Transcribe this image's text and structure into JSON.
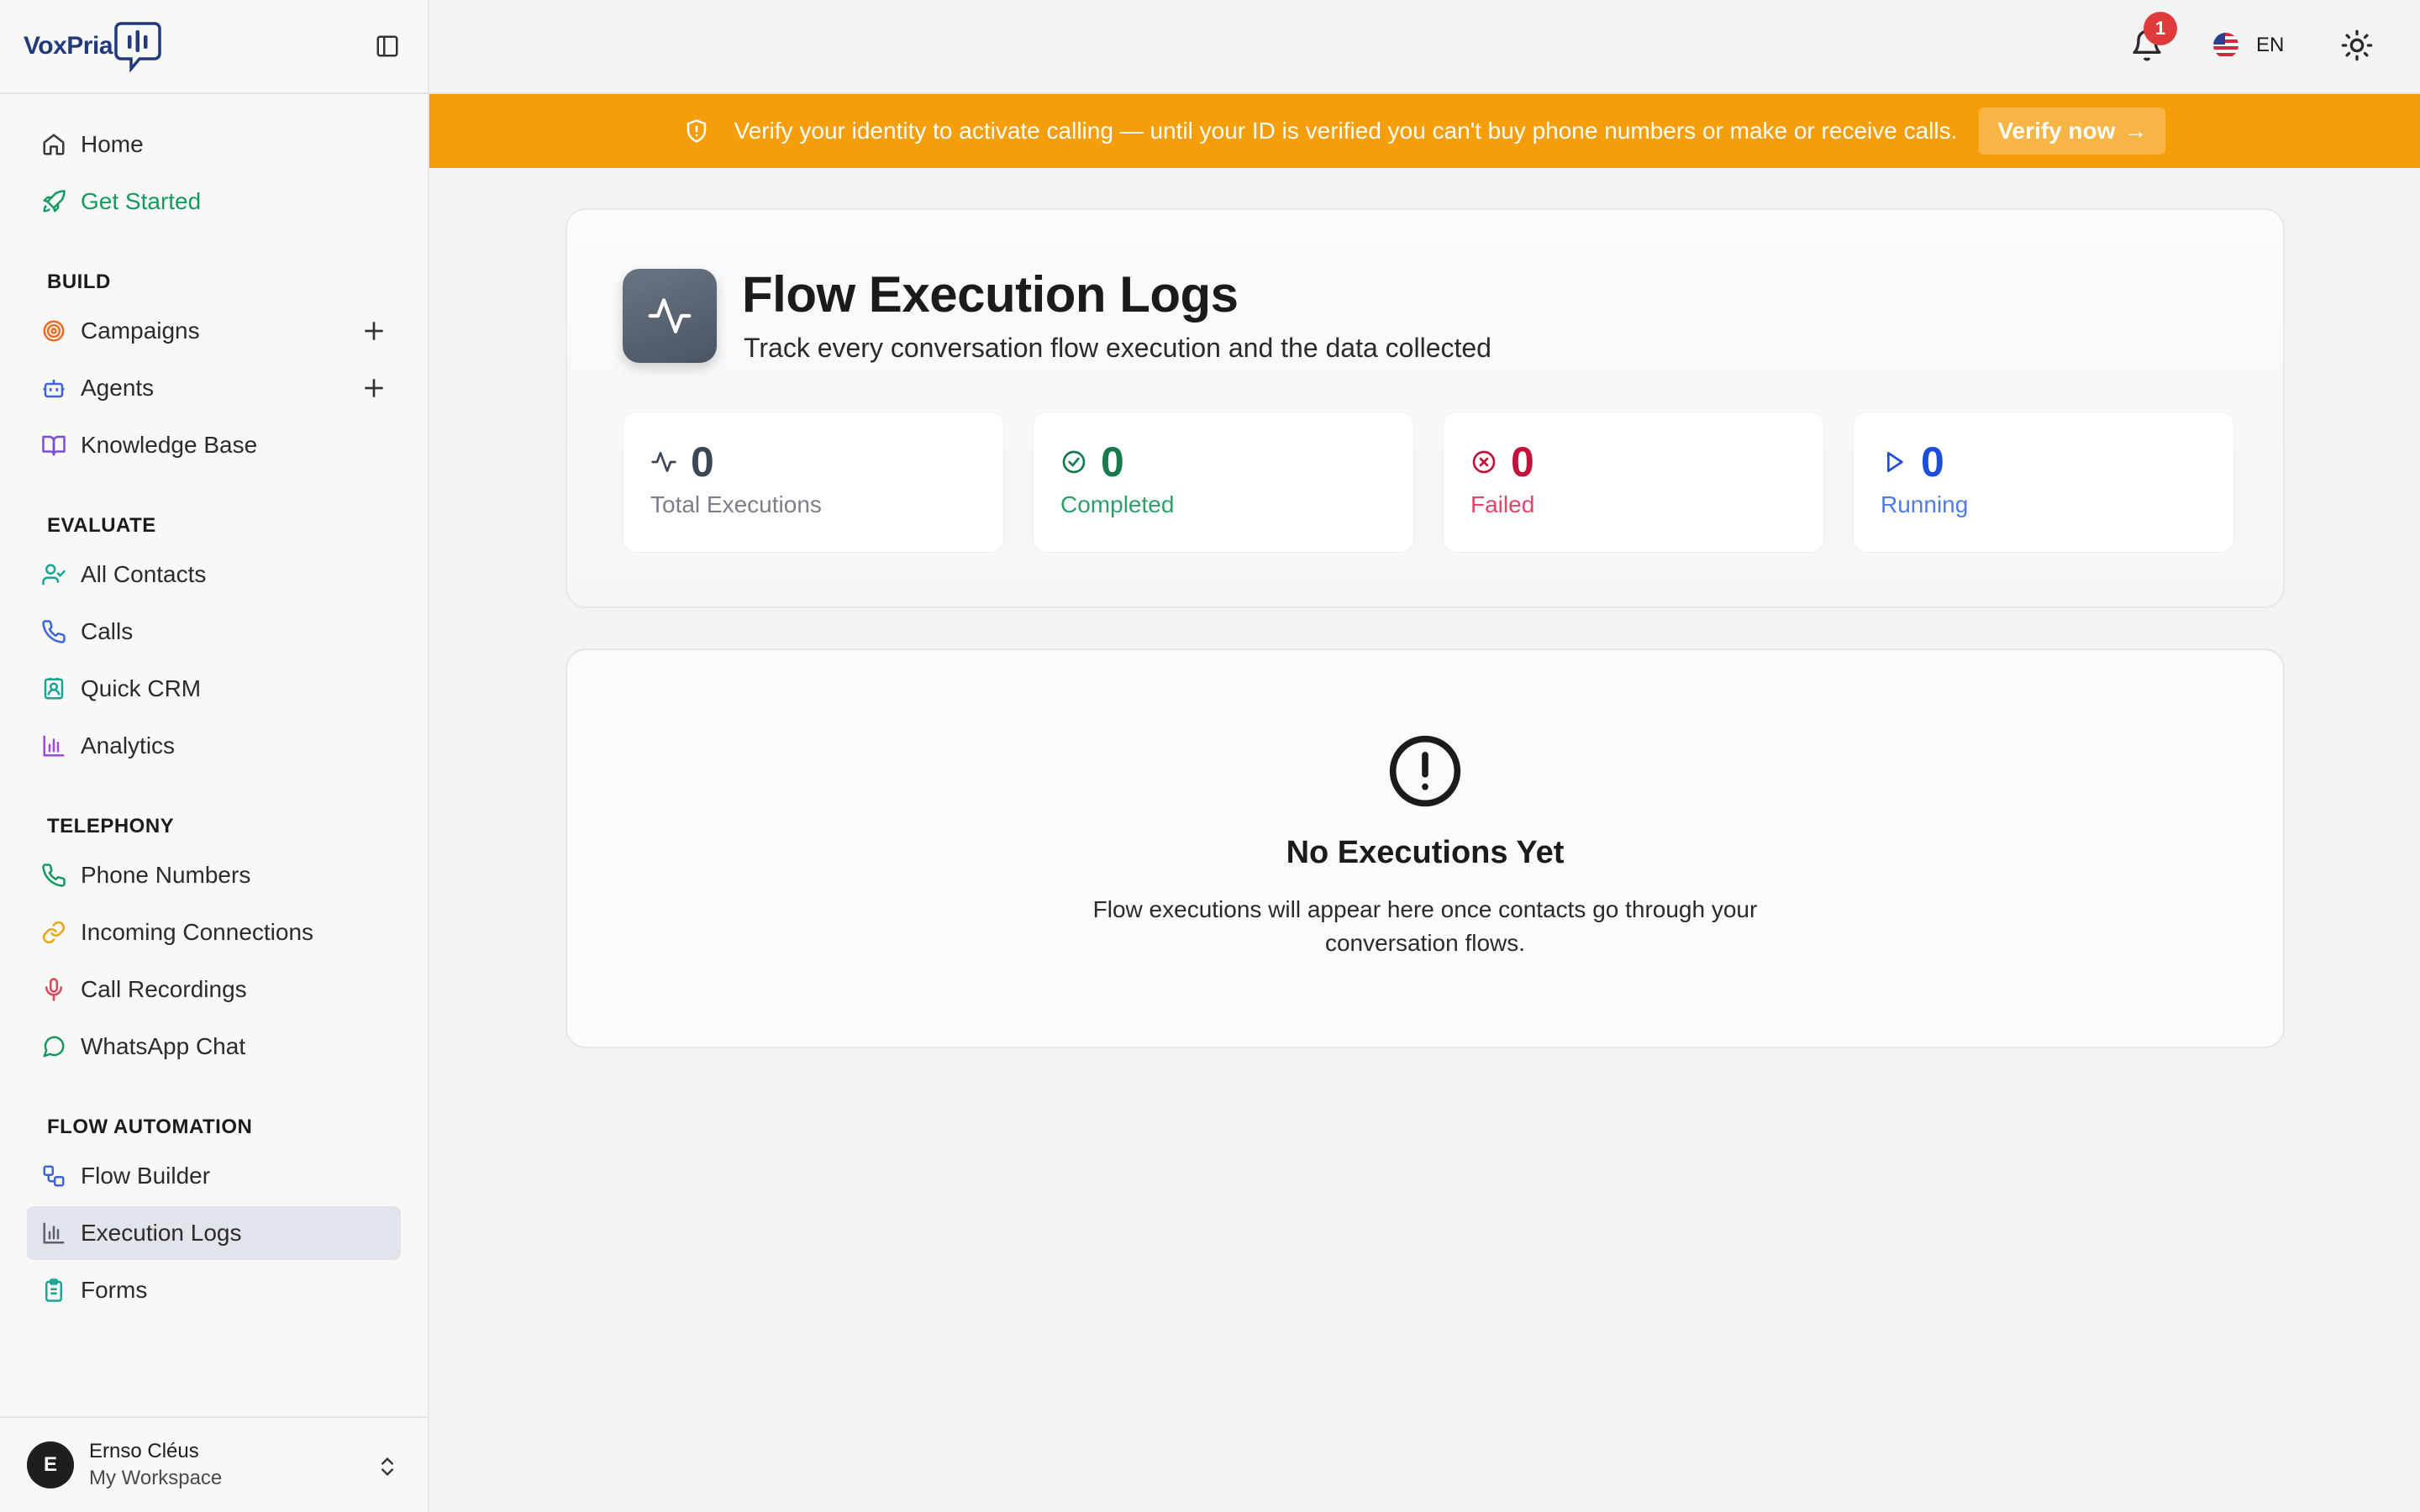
{
  "brand": {
    "name": "VoxPria"
  },
  "sidebar": {
    "top_items": [
      {
        "label": "Home",
        "icon": "home-icon"
      },
      {
        "label": "Get Started",
        "icon": "rocket-icon"
      }
    ],
    "sections": [
      {
        "title": "BUILD",
        "items": [
          {
            "label": "Campaigns",
            "icon": "target-icon",
            "has_add": true
          },
          {
            "label": "Agents",
            "icon": "bot-icon",
            "has_add": true
          },
          {
            "label": "Knowledge Base",
            "icon": "book-icon"
          }
        ]
      },
      {
        "title": "EVALUATE",
        "items": [
          {
            "label": "All Contacts",
            "icon": "user-check-icon"
          },
          {
            "label": "Calls",
            "icon": "phone-icon"
          },
          {
            "label": "Quick CRM",
            "icon": "contact-card-icon"
          },
          {
            "label": "Analytics",
            "icon": "bar-chart-icon"
          }
        ]
      },
      {
        "title": "TELEPHONY",
        "items": [
          {
            "label": "Phone Numbers",
            "icon": "phone-icon"
          },
          {
            "label": "Incoming Connections",
            "icon": "link-icon"
          },
          {
            "label": "Call Recordings",
            "icon": "mic-icon"
          },
          {
            "label": "WhatsApp Chat",
            "icon": "chat-bubble-icon"
          }
        ]
      },
      {
        "title": "FLOW AUTOMATION",
        "items": [
          {
            "label": "Flow Builder",
            "icon": "workflow-icon"
          },
          {
            "label": "Execution Logs",
            "icon": "bar-chart-icon",
            "active": true
          },
          {
            "label": "Forms",
            "icon": "clipboard-icon"
          }
        ]
      }
    ],
    "user": {
      "initial": "E",
      "name": "Ernso Cléus",
      "workspace": "My Workspace"
    }
  },
  "topbar": {
    "notification_count": "1",
    "language": "EN"
  },
  "banner": {
    "text": "Verify your identity to activate calling — until your ID is verified you can't buy phone numbers or make or receive calls.",
    "button_label": "Verify now",
    "button_arrow": "→",
    "color": "#f59e0b"
  },
  "header": {
    "title": "Flow Execution Logs",
    "subtitle": "Track every conversation flow execution and the data collected"
  },
  "stats": [
    {
      "value": "0",
      "label": "Total Executions",
      "icon": "activity-icon",
      "color": "#3d4656",
      "label_color": "#7a7f88"
    },
    {
      "value": "0",
      "label": "Completed",
      "icon": "check-circle-icon",
      "color": "#167a4e",
      "label_color": "#2f9e6a"
    },
    {
      "value": "0",
      "label": "Failed",
      "icon": "x-circle-icon",
      "color": "#c0143c",
      "label_color": "#e0456a"
    },
    {
      "value": "0",
      "label": "Running",
      "icon": "play-icon",
      "color": "#1d4ed8",
      "label_color": "#4f7be6"
    }
  ],
  "empty_state": {
    "title": "No Executions Yet",
    "description": "Flow executions will appear here once contacts go through your conversation flows."
  }
}
